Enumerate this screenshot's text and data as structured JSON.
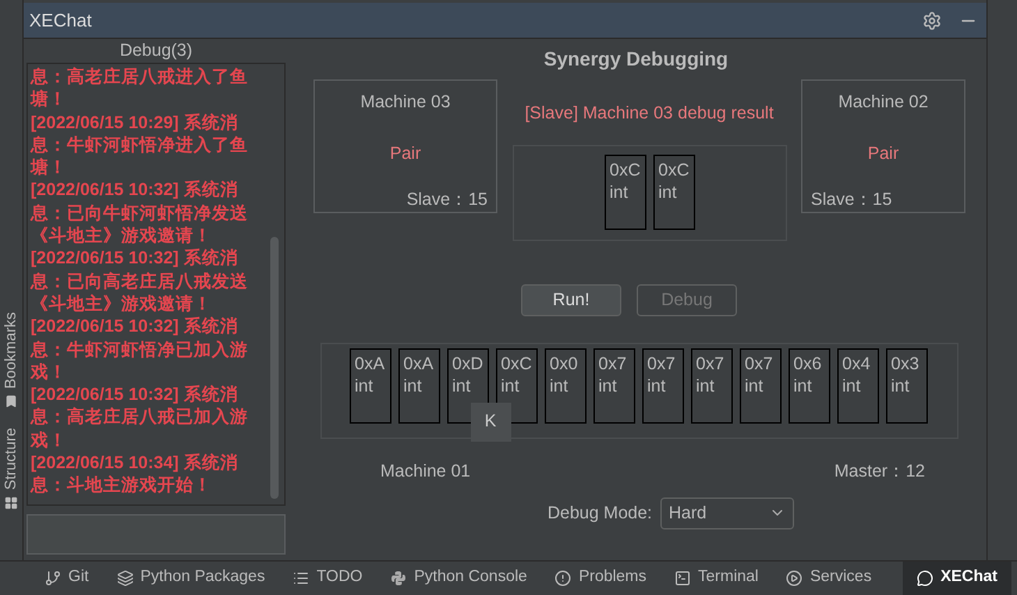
{
  "window": {
    "title": "XEChat"
  },
  "side_tabs": [
    {
      "label": "Bookmarks"
    },
    {
      "label": "Structure"
    }
  ],
  "chat": {
    "title": "Debug(3)",
    "messages": [
      "息：高老庄居八戒进入了鱼塘！",
      "[2022/06/15 10:29] 系统消息：牛虾河虾悟净进入了鱼塘！",
      "[2022/06/15 10:32] 系统消息：已向牛虾河虾悟净发送《斗地主》游戏邀请！",
      "[2022/06/15 10:32] 系统消息：已向高老庄居八戒发送《斗地主》游戏邀请！",
      "[2022/06/15 10:32] 系统消息：牛虾河虾悟净已加入游戏！",
      "[2022/06/15 10:32] 系统消息：高老庄居八戒已加入游戏！",
      "[2022/06/15 10:34] 系统消息：斗地主游戏开始！"
    ]
  },
  "game": {
    "title": "Synergy Debugging",
    "slaves": [
      {
        "name": "Machine 03",
        "status": "Pair",
        "role": "Slave：15"
      },
      {
        "name": "Machine 02",
        "status": "Pair",
        "role": "Slave：15"
      }
    ],
    "result_label": "[Slave] Machine 03 debug result",
    "slave_cells": [
      {
        "value": "0xC",
        "type": "int"
      },
      {
        "value": "0xC",
        "type": "int"
      }
    ],
    "buttons": [
      {
        "label": "Run!",
        "disabled": false
      },
      {
        "label": "Debug",
        "disabled": true
      }
    ],
    "master_cells": [
      {
        "value": "0xA",
        "type": "int"
      },
      {
        "value": "0xA",
        "type": "int"
      },
      {
        "value": "0xD",
        "type": "int"
      },
      {
        "value": "0xC",
        "type": "int"
      },
      {
        "value": "0x0",
        "type": "int"
      },
      {
        "value": "0x7",
        "type": "int"
      },
      {
        "value": "0x7",
        "type": "int"
      },
      {
        "value": "0x7",
        "type": "int"
      },
      {
        "value": "0x7",
        "type": "int"
      },
      {
        "value": "0x6",
        "type": "int"
      },
      {
        "value": "0x4",
        "type": "int"
      },
      {
        "value": "0x3",
        "type": "int"
      }
    ],
    "tooltip": "K",
    "master_name": "Machine 01",
    "master_role": "Master：12",
    "debug_mode": {
      "label": "Debug Mode:",
      "value": "Hard"
    }
  },
  "tool_tabs": [
    {
      "label": "Git",
      "selected": false
    },
    {
      "label": "Python Packages",
      "selected": false
    },
    {
      "label": "TODO",
      "selected": false
    },
    {
      "label": "Python Console",
      "selected": false
    },
    {
      "label": "Problems",
      "selected": false
    },
    {
      "label": "Terminal",
      "selected": false
    },
    {
      "label": "Services",
      "selected": false
    },
    {
      "label": "XEChat",
      "selected": true
    }
  ]
}
